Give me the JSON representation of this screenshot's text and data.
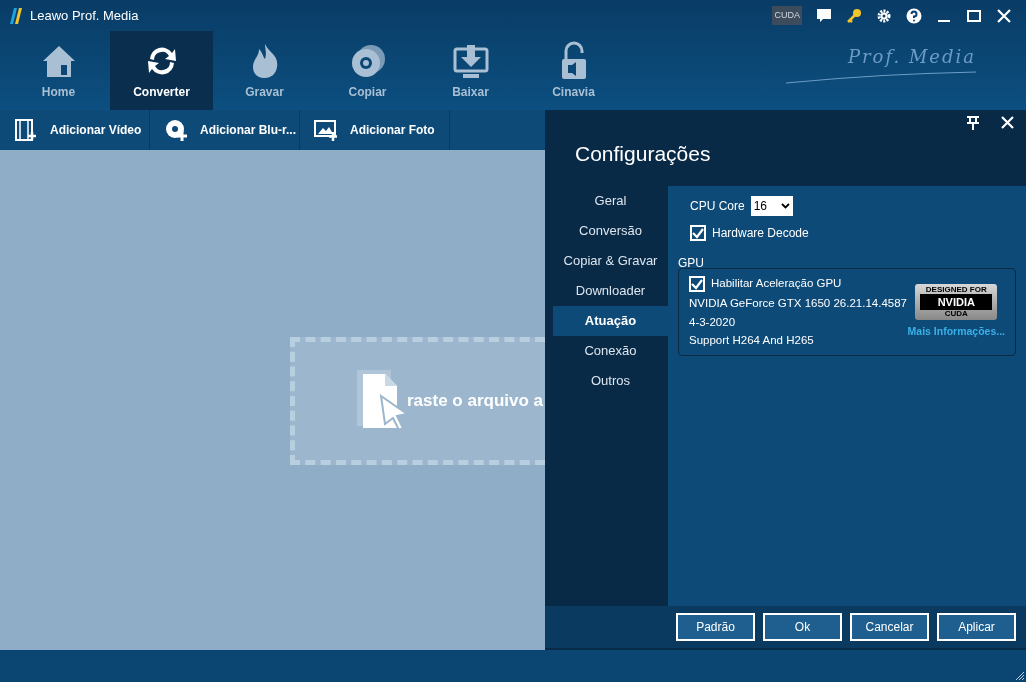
{
  "window": {
    "title": "Leawo Prof. Media"
  },
  "nav": [
    {
      "label": "Home",
      "kind": "home",
      "selected": false
    },
    {
      "label": "Converter",
      "kind": "convert",
      "selected": true
    },
    {
      "label": "Gravar",
      "kind": "flame",
      "selected": false
    },
    {
      "label": "Copiar",
      "kind": "disc",
      "selected": false
    },
    {
      "label": "Baixar",
      "kind": "download",
      "selected": false
    },
    {
      "label": "Cinavia",
      "kind": "lock",
      "selected": false
    }
  ],
  "brand": "Prof. Media",
  "toolbar": [
    {
      "label": "Adicionar Vídeo",
      "kind": "film"
    },
    {
      "label": "Adicionar Blu-r...",
      "kind": "disc"
    },
    {
      "label": "Adicionar Foto",
      "kind": "photo"
    }
  ],
  "drop_zone": {
    "text": "raste o arquivo a"
  },
  "settings": {
    "title": "Configurações",
    "categories": [
      {
        "label": "Geral",
        "selected": false
      },
      {
        "label": "Conversão",
        "selected": false
      },
      {
        "label": "Copiar & Gravar",
        "selected": false
      },
      {
        "label": "Downloader",
        "selected": false
      },
      {
        "label": "Atuação",
        "selected": true
      },
      {
        "label": "Conexão",
        "selected": false
      },
      {
        "label": "Outros",
        "selected": false
      }
    ],
    "cpu_core": {
      "label": "CPU Core",
      "value": "16"
    },
    "hardware_decode": {
      "label": "Hardware Decode",
      "checked": true
    },
    "gpu": {
      "legend": "GPU",
      "enable": {
        "label": "Habilitar Aceleração GPU",
        "checked": true
      },
      "lines": [
        "NVIDIA GeForce GTX 1650 26.21.14.4587",
        "4-3-2020",
        "Support H264 And H265"
      ],
      "badge": {
        "top": "DESIGNED FOR",
        "brand": "NVIDIA",
        "bottom": "CUDA"
      },
      "link": "Mais Informações..."
    },
    "buttons": [
      "Padrão",
      "Ok",
      "Cancelar",
      "Aplicar"
    ]
  },
  "cuda_badge": "CUDA"
}
